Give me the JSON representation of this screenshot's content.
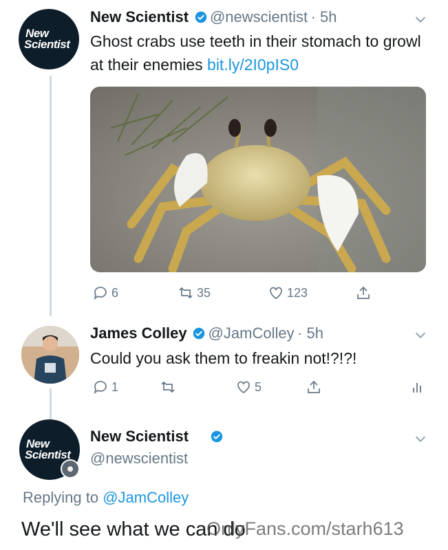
{
  "tweet1": {
    "avatar_line1": "New",
    "avatar_line2": "Scientist",
    "name": "New Scientist",
    "handle": "@newscientist",
    "time": "· 5h",
    "text": "Ghost crabs use teeth in their stomach to growl at their enemies",
    "link": "bit.ly/2I0pIS0",
    "image_alt": "ghost crab on sand",
    "replies": "6",
    "retweets": "35",
    "likes": "123"
  },
  "tweet2": {
    "name": "James Colley",
    "handle": "@JamColley",
    "time": "· 5h",
    "text": "Could you ask them to freakin not!?!?!",
    "replies": "1",
    "likes": "5"
  },
  "tweet3": {
    "avatar_line1": "New",
    "avatar_line2": "Scientist",
    "name": "New Scientist",
    "handle": "@newscientist",
    "replying_prefix": "Replying to",
    "replying_to": "@JamColley",
    "text": "We'll see what we can do"
  },
  "watermark": "OnlyFans.com/starh613",
  "colors": {
    "accent": "#1b95e0",
    "muted": "#657786",
    "thread_line": "#cfd9de",
    "ns_avatar": "#0d1e2a"
  }
}
